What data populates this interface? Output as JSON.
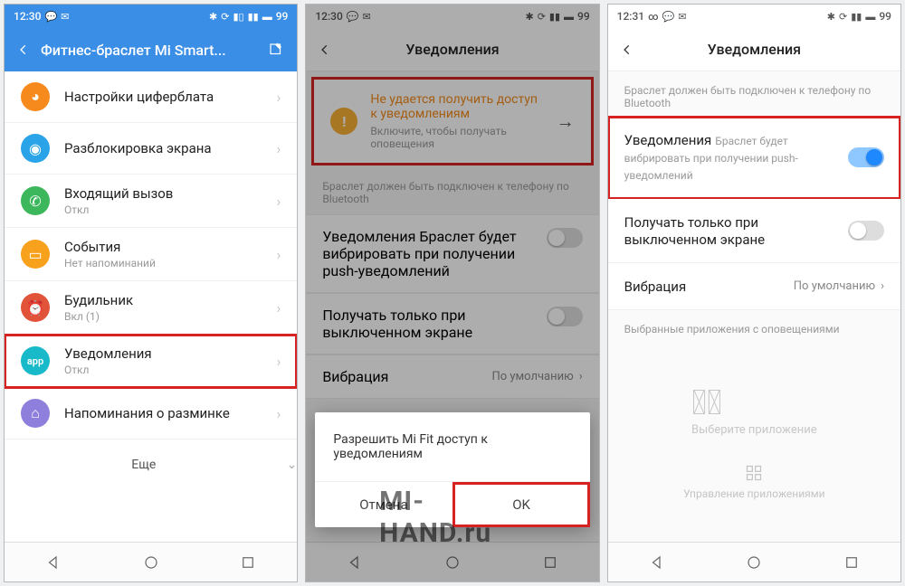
{
  "watermark": "MI-HAND.ru",
  "screen1": {
    "status": {
      "time": "12:30",
      "battery": "99"
    },
    "header": {
      "title": "Фитнес-браслет Mi Smart..."
    },
    "items": [
      {
        "icon": "dial-icon",
        "color": "#f78a1d",
        "label": "Настройки циферблата",
        "sub": ""
      },
      {
        "icon": "unlock-icon",
        "color": "#2aa3e8",
        "label": "Разблокировка экрана",
        "sub": ""
      },
      {
        "icon": "phone-icon",
        "color": "#3cb75c",
        "label": "Входящий вызов",
        "sub": "Откл"
      },
      {
        "icon": "events-icon",
        "color": "#f7a11d",
        "label": "События",
        "sub": "Нет напоминаний"
      },
      {
        "icon": "alarm-icon",
        "color": "#e2543a",
        "label": "Будильник",
        "sub": "Вкл (1)"
      },
      {
        "icon": "app-icon",
        "color": "#18b9c9",
        "label": "Уведомления",
        "sub": "Откл",
        "highlight": true
      },
      {
        "icon": "idle-icon",
        "color": "#8f7fdc",
        "label": "Напоминания о разминке",
        "sub": ""
      }
    ],
    "more": "Еще"
  },
  "screen2": {
    "status": {
      "time": "12:30",
      "battery": "99"
    },
    "header": {
      "title": "Уведомления"
    },
    "warn": {
      "title": "Не удается получить доступ к уведомлениям",
      "sub": "Включите, чтобы получать оповещения"
    },
    "note": "Браслет должен быть подключен к телефону по Bluetooth",
    "toggle1": {
      "title": "Уведомления",
      "sub": "Браслет будет вибрировать при получении push-уведомлений"
    },
    "toggle2": {
      "title": "Получать только при выключенном экране"
    },
    "vibration": {
      "label": "Вибрация",
      "value": "По умолчанию"
    },
    "dialog": {
      "body": "Разрешить Mi Fit доступ к уведомлениям",
      "cancel": "Отмена",
      "ok": "OK"
    }
  },
  "screen3": {
    "status": {
      "time": "12:31",
      "battery": "99"
    },
    "header": {
      "title": "Уведомления"
    },
    "note": "Браслет должен быть подключен к телефону по Bluetooth",
    "toggle1": {
      "title": "Уведомления",
      "sub": "Браслет будет вибрировать при получении push-уведомлений"
    },
    "toggle2": {
      "title": "Получать только при выключенном экране"
    },
    "vibration": {
      "label": "Вибрация",
      "value": "По умолчанию"
    },
    "selected_apps_label": "Выбранные приложения с оповещениями",
    "empty": "Выберите приложение",
    "manage": "Управление приложениями"
  }
}
